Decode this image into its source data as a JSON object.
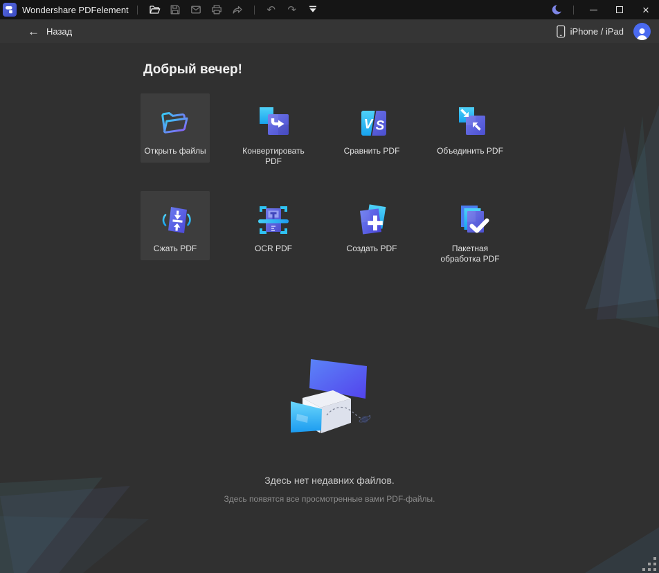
{
  "titlebar": {
    "app_title": "Wondershare PDFelement",
    "undo_glyph": "↶",
    "redo_glyph": "↷",
    "close_glyph": "×"
  },
  "navbar": {
    "back_glyph": "←",
    "back_label": "Назад",
    "device_label": "iPhone / iPad"
  },
  "main": {
    "greeting": "Добрый вечер!",
    "tiles": [
      {
        "label": "Открыть файлы",
        "icon": "open-folder-icon",
        "highlighted": true
      },
      {
        "label": "Конвертировать PDF",
        "icon": "convert-pdf-icon",
        "highlighted": false
      },
      {
        "label": "Сравнить PDF",
        "icon": "compare-pdf-icon",
        "highlighted": false
      },
      {
        "label": "Объединить PDF",
        "icon": "merge-pdf-icon",
        "highlighted": false
      },
      {
        "label": "Сжать PDF",
        "icon": "compress-pdf-icon",
        "highlighted": true
      },
      {
        "label": "OCR PDF",
        "icon": "ocr-pdf-icon",
        "highlighted": false
      },
      {
        "label": "Создать PDF",
        "icon": "create-pdf-icon",
        "highlighted": false
      },
      {
        "label": "Пакетная обработка PDF",
        "icon": "batch-process-pdf-icon",
        "highlighted": false
      }
    ],
    "compare_letters": {
      "v": "V",
      "s": "S"
    },
    "empty_state": {
      "title": "Здесь нет недавних файлов.",
      "subtitle": "Здесь появятся все просмотренные вами PDF-файлы."
    }
  },
  "colors": {
    "titlebar_bg": "#151515",
    "navbar_bg": "#353535",
    "main_bg": "#303030",
    "tile_highlight_bg": "#3d3d3d",
    "accent_blue": "#4a6af0",
    "moon": "#7d85e6",
    "icon_cyan": "#2bb7f0",
    "icon_indigo": "#5a5fd6"
  }
}
